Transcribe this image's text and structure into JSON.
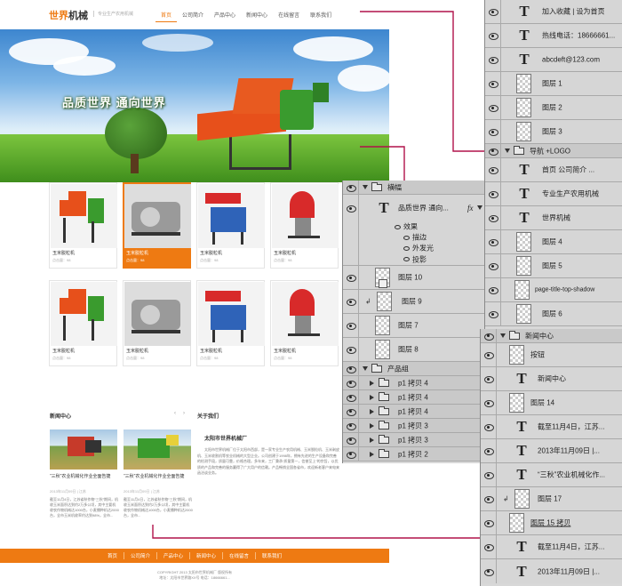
{
  "site": {
    "logo_main": "世界",
    "logo_accent": "机械",
    "slogan": "专业生产农用机械",
    "nav": [
      "首页",
      "公司简介",
      "产品中心",
      "新闻中心",
      "在线留言",
      "联系我们"
    ],
    "banner_text": "品质世界   通向世界",
    "products": [
      {
        "name": "玉米脱粒机",
        "meta": "点击量：98"
      },
      {
        "name": "玉米脱粒机",
        "meta": "点击量：98"
      },
      {
        "name": "玉米脱粒机",
        "meta": "点击量：98"
      },
      {
        "name": "玉米脱粒机",
        "meta": "点击量：98"
      },
      {
        "name": "玉米脱粒机",
        "meta": "点击量：98"
      },
      {
        "name": "玉米脱粒机",
        "meta": "点击量：98"
      },
      {
        "name": "玉米脱粒机",
        "meta": "点击量：98"
      },
      {
        "name": "玉米脱粒机",
        "meta": "点击量：98"
      }
    ],
    "news_title": "新闻中心",
    "pager_prev": "‹",
    "pager_next": "›",
    "news": [
      {
        "title": "“三秋”农业机械化作业全面告捷",
        "date": "2013年11月09日  |  江苏",
        "body": "截至11月4日，江苏省秋作物“三秋”期间，机收玉米面积达到约2万多公顷，其中主要机收农作物机械达1000台，小麦播种机达2000台，全市玉米机收率约达到98%，全市..."
      },
      {
        "title": "“三秋”农业机械化作业全面告捷",
        "date": "2013年11月09日  |  江苏",
        "body": "截至11月4日，江苏省秋作物“三秋”期间，机收玉米面积达到约2万多公顷，其中主要机收农作物机械达1000台，小麦播种机达2000台，全市..."
      }
    ],
    "about_title": "关于我们",
    "about_name": "太阳市世界机械厂",
    "about_body": "太阳市世界机械厂位于太阳市西部，是一家专业生产农用机械、玉米脱粒机、玉米剥皮机、玉米收割机等农业机械的大型企业。公司创建于1998年，拥有先进的生产设备和完善的检测手段，质量可靠，价格合理。多年来，工厂秉承“质量第一，信誉至上”的宗旨，以优质的产品和完善的服务赢得了广大用户的信赖。产品畅销全国各省市，欢迎新老客户来电来函洽谈业务。",
    "footer_nav": [
      "首页",
      "公司简介",
      "产品中心",
      "新闻中心",
      "在线留言",
      "联系我们"
    ],
    "copyright": "COPYRIGHT 2013 太阳市世界机械厂 版权所有",
    "address": "地址：太阳市世界路XX号  电话：18666661..."
  },
  "panel1": [
    {
      "type": "text",
      "name": "加入收藏  |  设为首页"
    },
    {
      "type": "text",
      "name": "热线电话：18666661..."
    },
    {
      "type": "text",
      "name": "abcdeft@123.com"
    },
    {
      "type": "image",
      "name": "图层 1"
    },
    {
      "type": "image",
      "name": "图层 2"
    },
    {
      "type": "image",
      "name": "图层 3"
    },
    {
      "type": "group",
      "name": "导航 +LOGO"
    },
    {
      "type": "text",
      "name": "首页      公司简介 ..."
    },
    {
      "type": "text",
      "name": "专业生产农用机械"
    },
    {
      "type": "text",
      "name": "世界机械"
    },
    {
      "type": "image",
      "name": "图层 4"
    },
    {
      "type": "image",
      "name": "图层 5"
    },
    {
      "type": "image",
      "name": "page-title-top-shadow"
    },
    {
      "type": "image",
      "name": "图层 6"
    }
  ],
  "panel2": {
    "group_name": "横幅",
    "text_layer": "品质世界  通向...",
    "effects_label": "效果",
    "effects": [
      "描边",
      "外发光",
      "投影"
    ],
    "layers": [
      "图层 10",
      "图层 9",
      "图层 7",
      "图层 8"
    ],
    "product_group": "产品组",
    "product_copies": [
      "p1 拷贝 4",
      "p1 拷贝 4",
      "p1 拷贝 4",
      "p1 拷贝 3",
      "p1 拷贝 3",
      "p1 拷贝 2"
    ]
  },
  "panel3": [
    {
      "type": "group",
      "name": "新闻中心"
    },
    {
      "type": "image",
      "name": "按钮"
    },
    {
      "type": "text",
      "name": "新闻中心"
    },
    {
      "type": "image",
      "name": "图层 14"
    },
    {
      "type": "text",
      "name": "截至11月4日，江苏..."
    },
    {
      "type": "text",
      "name": "2013年11月09日  |..."
    },
    {
      "type": "text",
      "name": "“三秋”农业机械化作..."
    },
    {
      "type": "image",
      "name": "图层 17"
    },
    {
      "type": "image",
      "name": "图层 15 拷贝"
    },
    {
      "type": "text",
      "name": "截至11月4日，江苏..."
    },
    {
      "type": "text",
      "name": "2013年11月09日  |..."
    }
  ]
}
